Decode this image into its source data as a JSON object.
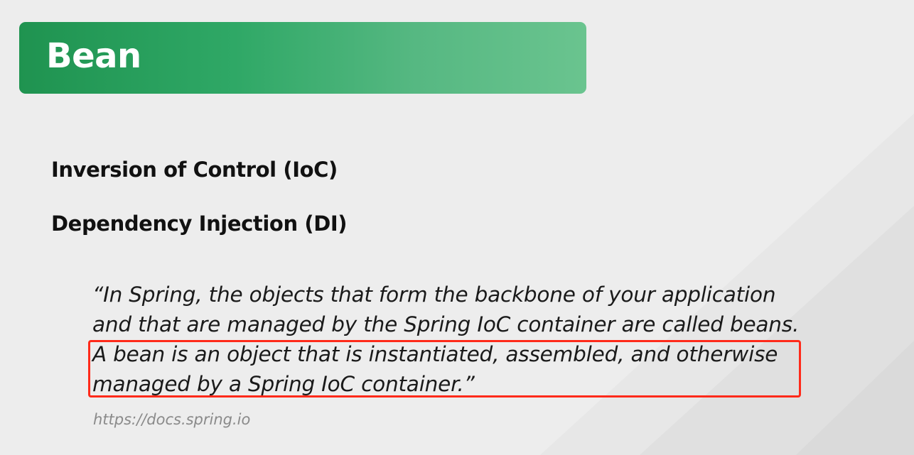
{
  "slide": {
    "title": "Bean",
    "headings": [
      "Inversion of Control (IoC)",
      "Dependency Injection (DI)"
    ],
    "quote_lines": [
      "“In Spring, the objects that form the backbone of your application",
      "and that are managed by the Spring IoC container are called beans.",
      "A bean is an object that is instantiated, assembled, and otherwise",
      "managed by a Spring IoC container.”"
    ],
    "source": "https://docs.spring.io"
  },
  "colors": {
    "banner_start": "#1f9350",
    "banner_end": "#6ac48f",
    "highlight_border": "#ff2a1a",
    "background": "#ededed"
  }
}
